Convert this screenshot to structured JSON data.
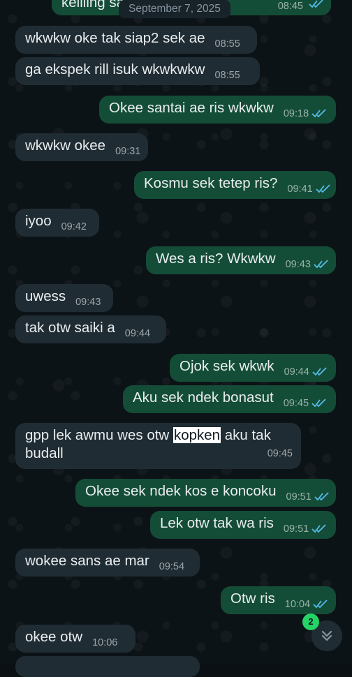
{
  "date_chip": "September 7, 2025",
  "messages": [
    {
      "text": "keliling sa",
      "time": "08:45",
      "dir": "out"
    },
    {
      "text": "wkwkw oke tak siap2 sek ae",
      "time": "08:55",
      "dir": "in"
    },
    {
      "text": "ga ekspek rill isuk wkwkwkw",
      "time": "08:55",
      "dir": "in"
    },
    {
      "text": "Okee santai ae ris wkwkw",
      "time": "09:18",
      "dir": "out"
    },
    {
      "text": "wkwkw okee",
      "time": "09:31",
      "dir": "in"
    },
    {
      "text": "Kosmu sek tetep ris?",
      "time": "09:41",
      "dir": "out"
    },
    {
      "text": "iyoo",
      "time": "09:42",
      "dir": "in"
    },
    {
      "text": "Wes a ris? Wkwkw",
      "time": "09:43",
      "dir": "out"
    },
    {
      "text": "uwess",
      "time": "09:43",
      "dir": "in"
    },
    {
      "text": "tak otw saiki a",
      "time": "09:44",
      "dir": "in"
    },
    {
      "text": "Ojok sek wkwk",
      "time": "09:44",
      "dir": "out"
    },
    {
      "text": "Aku sek ndek bonasut",
      "time": "09:45",
      "dir": "out"
    },
    {
      "text_before": "gpp lek awmu wes otw ",
      "text_highlight": "kopken",
      "text_after": " aku tak",
      "text_line2": "budall",
      "time": "09:45",
      "dir": "in"
    },
    {
      "text": "Okee sek ndek kos e koncoku",
      "time": "09:51",
      "dir": "out"
    },
    {
      "text": "Lek otw tak wa ris",
      "time": "09:51",
      "dir": "out"
    },
    {
      "text": "wokee sans ae mar",
      "time": "09:54",
      "dir": "in"
    },
    {
      "text": "Otw ris",
      "time": "10:04",
      "dir": "out"
    },
    {
      "text": "okee otw",
      "time": "10:06",
      "dir": "in"
    }
  ],
  "unread_badge": "2",
  "icons": {
    "read_ticks": "double-check-icon",
    "scroll_down": "chevrons-down-icon"
  },
  "colors": {
    "incoming": "#202c33",
    "outgoing": "#144d37",
    "ticks": "#53bdeb",
    "badge": "#25d366"
  }
}
